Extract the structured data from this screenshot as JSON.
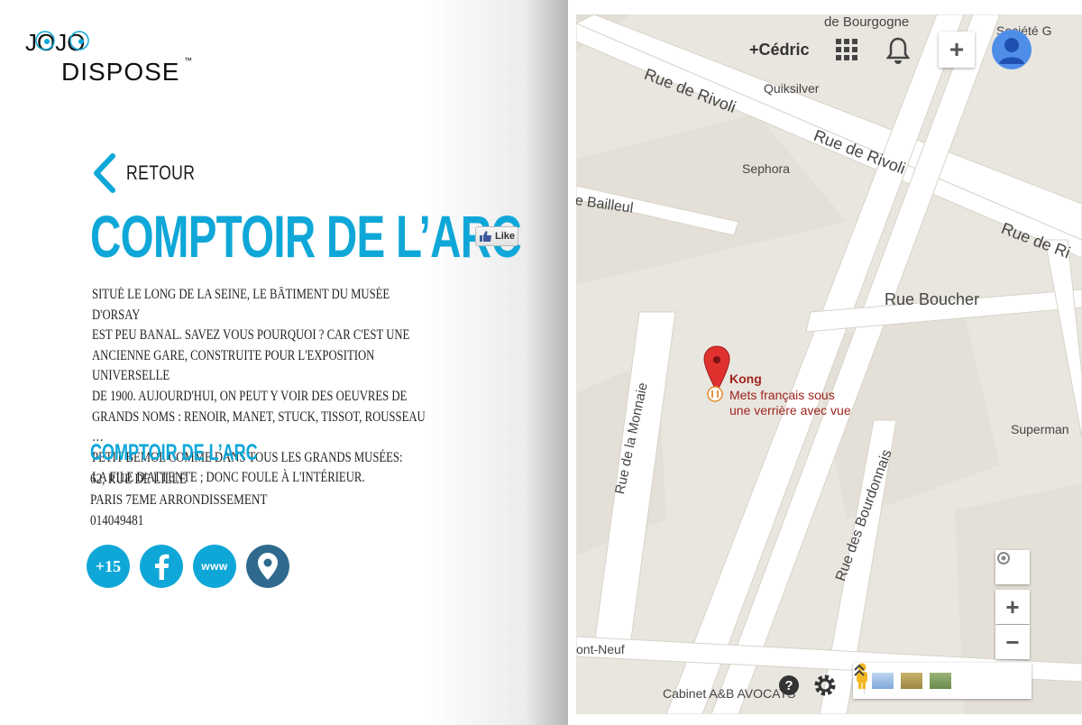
{
  "brand": {
    "logo_top": "JOJO",
    "logo_bottom": "DISPOSE",
    "trademark": "™"
  },
  "nav": {
    "back_label": "RETOUR"
  },
  "venue": {
    "title": "COMPTOIR DE L’ARC",
    "like_label": "Like",
    "description_lines": [
      "Situé le long de la Seine, le bâtiment du musée d'Orsay",
      "est peu banal. Savez vous pourquoi ? Car c'est une",
      "ancienne gare, construite pour l'exposition universelle",
      "de 1900. Aujourd'hui, on peut y voir des oeuvres de",
      "grands noms : Renoir, Manet, Stuck, Tissot, Rousseau …",
      "Petit bémol comme dans tous les grands musées:",
      "la file d'attente ; donc foule à l'intérieur."
    ],
    "name": "COMPTOIR DE L’ARC",
    "address_line1": "62, rue de Lille",
    "address_line2": "Paris 7eme arrondissement",
    "phone": "014049481"
  },
  "actions": {
    "rating_label": "+15",
    "www_label": "www"
  },
  "colors": {
    "accent": "#0fa7d8",
    "dark_pin": "#2f6a8e",
    "map_bg": "#e9e6df",
    "road": "#ffffff"
  },
  "map": {
    "user_name": "+Cédric",
    "streets": {
      "rivoli_1": "Rue de Rivoli",
      "rivoli_2": "Rue de Rivoli",
      "rivoli_3": "Rue de Ri",
      "bourgogne": "de Bourgogne",
      "bailleul": "e Bailleul",
      "boucher": "Rue Boucher",
      "monnaie": "Rue de la Monnaie",
      "bourdonnais": "Rue des Bourdonnais",
      "pont_neuf": "ont-Neuf",
      "cabinet": "Cabinet A&B AVOCATS",
      "superm": "Superman",
      "societe": "Société G"
    },
    "pois": {
      "quiksilver": "Quiksilver",
      "sephora": "Sephora"
    },
    "place": {
      "name": "Kong",
      "desc_line1": "Mets français sous",
      "desc_line2": "une verrière avec vue"
    }
  }
}
